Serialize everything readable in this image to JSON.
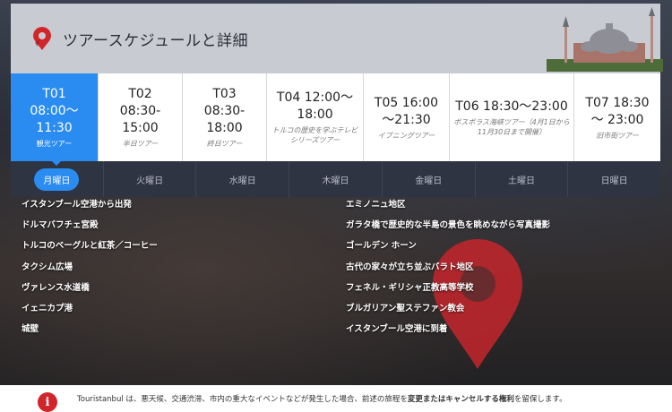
{
  "header": {
    "title": "ツアースケジュールと詳細",
    "pin_icon": "location-pin-icon",
    "accent": "#d0262b"
  },
  "tabs": [
    {
      "lines": [
        "T01",
        "08:00〜",
        "11:30"
      ],
      "sub": "観光ツアー",
      "active": true
    },
    {
      "lines": [
        "T02",
        "08:30-",
        "15:00"
      ],
      "sub": "半日ツアー",
      "active": false
    },
    {
      "lines": [
        "T03",
        "08:30-",
        "18:00"
      ],
      "sub": "終日ツアー",
      "active": false
    },
    {
      "lines": [
        "T04 12:00〜",
        "18:00"
      ],
      "sub": "トルコの歴史を学ぶテレビシリーズツアー",
      "active": false
    },
    {
      "lines": [
        "T05 16:00",
        "〜21:30"
      ],
      "sub": "イブニングツアー",
      "active": false
    },
    {
      "lines": [
        "T06 18:30〜23:00"
      ],
      "sub": "ボスポラス海峡ツアー（4月1日から 11月30日まで開催）",
      "active": false
    },
    {
      "lines": [
        "T07 18:30",
        "〜 23:00"
      ],
      "sub": "旧市街ツアー",
      "active": false
    }
  ],
  "days": [
    "月曜日",
    "火曜日",
    "水曜日",
    "木曜日",
    "金曜日",
    "土曜日",
    "日曜日"
  ],
  "itinerary": {
    "left": [
      "イスタンブール空港から出発",
      "ドルマバフチェ宮殿",
      "トルコのベーグルと紅茶／コーヒー",
      "タクシム広場",
      "ヴァレンス水道橋",
      "イェニカプ港",
      "城壁"
    ],
    "right": [
      "エミノニュ地区",
      "ガラタ橋で歴史的な半島の景色を眺めながら写真撮影",
      "ゴールデン ホーン",
      "古代の家々が立ち並ぶバラト地区",
      "フェネル・ギリシャ正教高等学校",
      "ブルガリアン聖ステファン教会",
      "イスタンブール空港に到着"
    ]
  },
  "footer": {
    "icon": "info-icon",
    "glyph": "i",
    "text_before": "Touristanbul は、悪天候、交通渋滞、市内の重大なイベントなどが発生した場合、前述の旅程を",
    "text_bold": "変更またはキャンセルする権利",
    "text_after": "を留保します。"
  }
}
